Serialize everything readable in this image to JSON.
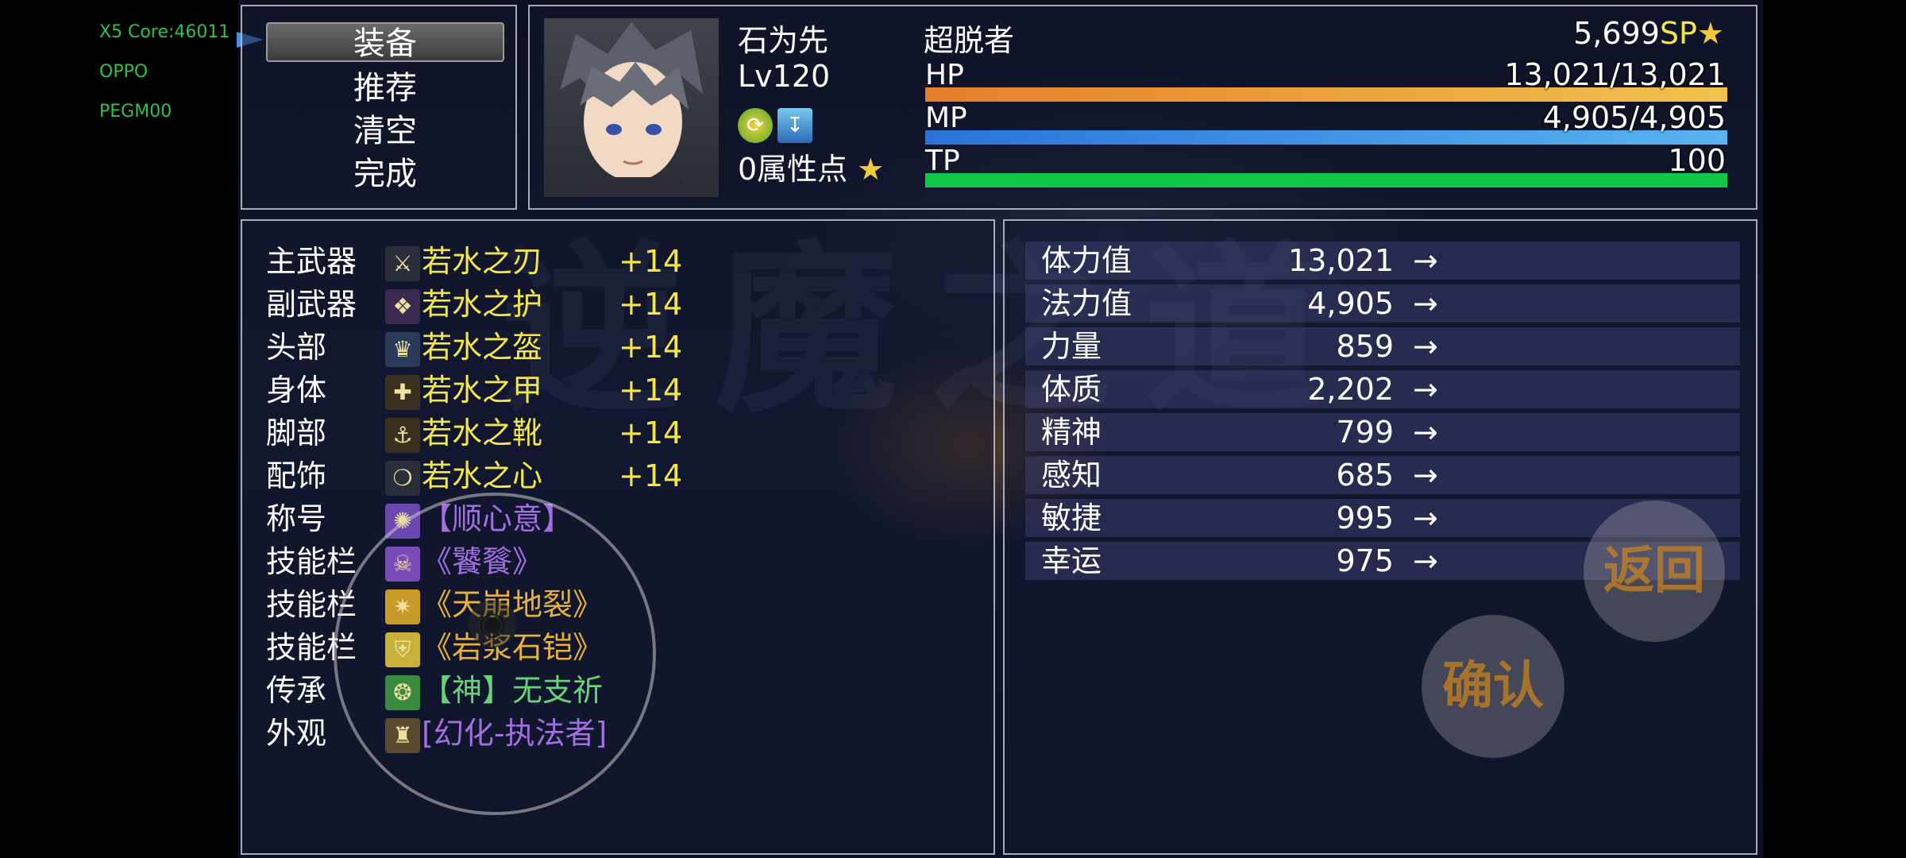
{
  "debug": {
    "core": "X5 Core:46011",
    "brand": "OPPO",
    "model": "PEGM00"
  },
  "commands": [
    {
      "label": "装备",
      "selected": true
    },
    {
      "label": "推荐",
      "selected": false
    },
    {
      "label": "清空",
      "selected": false
    },
    {
      "label": "完成",
      "selected": false
    }
  ],
  "actor": {
    "name": "石为先",
    "class": "超脱者",
    "level": "Lv120",
    "sp": "5,699",
    "sp_unit": "SP",
    "attr_points": "0属性点",
    "state_icons": [
      "buff-spiral-icon",
      "water-drop-icon"
    ],
    "hp_label": "HP",
    "hp_text": "13,021/13,021",
    "hp_ratio": 1.0,
    "mp_label": "MP",
    "mp_text": "4,905/4,905",
    "mp_ratio": 1.0,
    "tp_label": "TP",
    "tp_text": "100",
    "tp_ratio": 1.0
  },
  "equipment": [
    {
      "slot": "主武器",
      "item": "若水之刃",
      "plus": "+14",
      "color": "#f3e64a",
      "icon": "sword-icon"
    },
    {
      "slot": "副武器",
      "item": "若水之护",
      "plus": "+14",
      "color": "#f3e64a",
      "icon": "shield-wing-icon"
    },
    {
      "slot": "头部",
      "item": "若水之盔",
      "plus": "+14",
      "color": "#f3e64a",
      "icon": "helmet-icon"
    },
    {
      "slot": "身体",
      "item": "若水之甲",
      "plus": "+14",
      "color": "#f3e64a",
      "icon": "armor-icon"
    },
    {
      "slot": "脚部",
      "item": "若水之靴",
      "plus": "+14",
      "color": "#f3e64a",
      "icon": "boots-icon"
    },
    {
      "slot": "配饰",
      "item": "若水之心",
      "plus": "+14",
      "color": "#f3e64a",
      "icon": "necklace-icon"
    },
    {
      "slot": "称号",
      "item": "【顺心意】",
      "plus": "",
      "color": "#a070e0",
      "icon": "title-seal-icon"
    },
    {
      "slot": "技能栏",
      "item": "《饕餮》",
      "plus": "",
      "color": "#a070e0",
      "icon": "beast-mask-icon"
    },
    {
      "slot": "技能栏",
      "item": "《天崩地裂》",
      "plus": "",
      "color": "#e8b23a",
      "icon": "earth-burst-icon"
    },
    {
      "slot": "技能栏",
      "item": "《岩浆石铠》",
      "plus": "",
      "color": "#e8b23a",
      "icon": "magma-shield-icon"
    },
    {
      "slot": "传承",
      "item": "【神】无支祈",
      "plus": "",
      "color": "#6cd07a",
      "icon": "inheritance-icon"
    },
    {
      "slot": "外观",
      "item": "[幻化-执法者]",
      "plus": "",
      "color": "#a070e0",
      "icon": "appearance-icon"
    }
  ],
  "stats": [
    {
      "label": "体力值",
      "value": "13,021",
      "arrow": "→"
    },
    {
      "label": "法力值",
      "value": "4,905",
      "arrow": "→"
    },
    {
      "label": "力量",
      "value": "859",
      "arrow": "→"
    },
    {
      "label": "体质",
      "value": "2,202",
      "arrow": "→"
    },
    {
      "label": "精神",
      "value": "799",
      "arrow": "→"
    },
    {
      "label": "感知",
      "value": "685",
      "arrow": "→"
    },
    {
      "label": "敏捷",
      "value": "995",
      "arrow": "→"
    },
    {
      "label": "幸运",
      "value": "975",
      "arrow": "→"
    }
  ],
  "buttons": {
    "back": "返回",
    "confirm": "确认"
  },
  "colors": {
    "hp_start": "#e67d2a",
    "hp_end": "#f2c24e",
    "mp_start": "#2a72d8",
    "mp_end": "#58b4f0",
    "tp": "#0fc84a",
    "sp_unit": "#f3e64a",
    "attr_points": "#f3e64a"
  }
}
